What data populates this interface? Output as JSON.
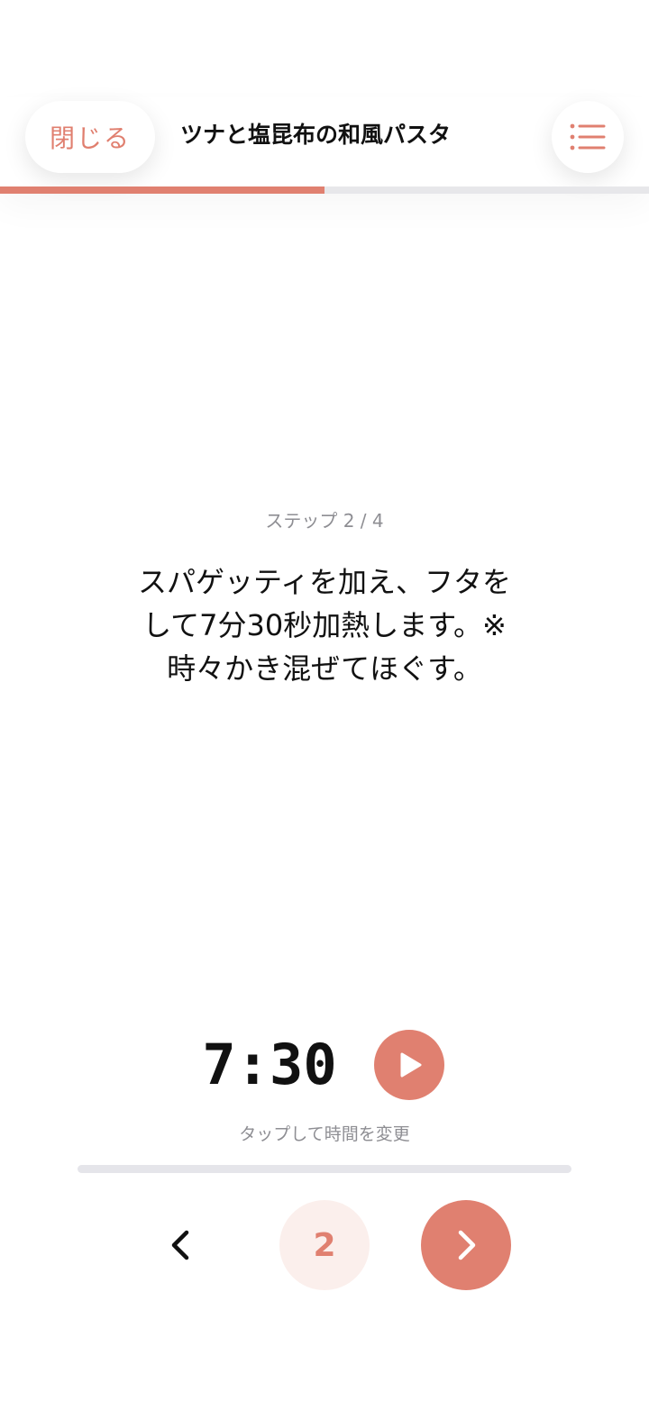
{
  "header": {
    "close_label": "閉じる",
    "title": "ツナと塩昆布の和風パスタ",
    "menu_icon": "list-icon"
  },
  "progress": {
    "fraction": 0.5
  },
  "step": {
    "label": "ステップ 2 / 4",
    "instruction_lines": [
      "スパゲッティを加え、フタを",
      "して7分30秒加熱します。※",
      "時々かき混ぜてほぐす。"
    ]
  },
  "timer": {
    "value": "7:30",
    "hint": "タップして時間を変更",
    "play_icon": "play-icon",
    "progress_fraction": 0
  },
  "navigation": {
    "prev_icon": "chevron-left-icon",
    "current_step": "2",
    "next_icon": "chevron-right-icon"
  },
  "colors": {
    "accent": "#e08070",
    "accent_light": "#fbefec",
    "track": "#e7e7ea",
    "muted_text": "#8e8e93"
  }
}
